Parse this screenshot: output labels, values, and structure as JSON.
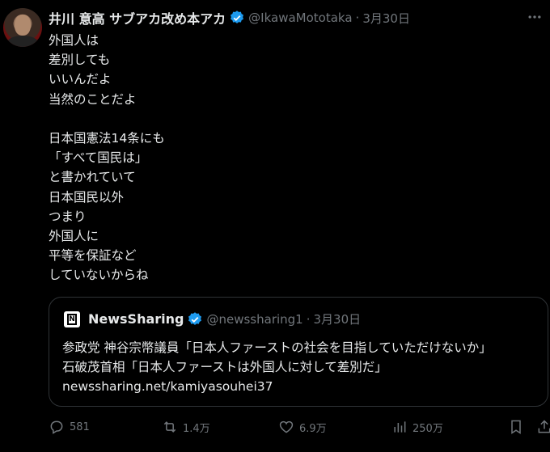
{
  "tweet": {
    "author_name": "井川 意高 サブアカ改め本アカ",
    "handle": "@IkawaMototaka",
    "separator": "·",
    "date": "3月30日",
    "lines_block1": [
      "外国人は",
      "差別しても",
      "いいんだよ",
      "当然のことだよ"
    ],
    "lines_block2": [
      "日本国憲法14条にも",
      "「すべて国民は」",
      "と書かれていて",
      "日本国民以外",
      "つまり",
      "外国人に",
      "平等を保証など",
      "していないからね"
    ]
  },
  "quote": {
    "author_name": "NewsSharing",
    "handle": "@newssharing1",
    "separator": "·",
    "date": "3月30日",
    "lines": [
      "参政党 神谷宗幣議員「日本人ファーストの社会を目指していただけないか」",
      "石破茂首相「日本人ファーストは外国人に対して差別だ」",
      "newssharing.net/kamiyasouhei37"
    ]
  },
  "actions": {
    "replies": "581",
    "retweets": "1.4万",
    "likes": "6.9万",
    "views": "250万"
  },
  "colors": {
    "background": "#000000",
    "text": "#e7e9ea",
    "muted": "#71767b",
    "verified": "#1d9bf0",
    "border": "#2f3336"
  }
}
